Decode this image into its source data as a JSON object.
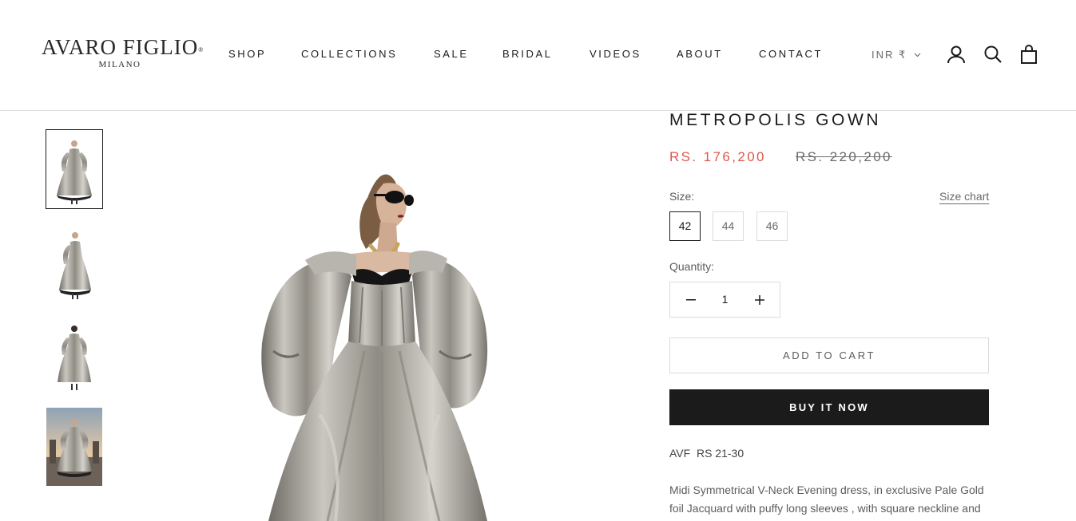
{
  "brand": {
    "logo_main": "AVARO FIGLIO",
    "logo_mark": "®",
    "logo_sub": "MILANO"
  },
  "nav": {
    "items": [
      {
        "label": "SHOP"
      },
      {
        "label": "COLLECTIONS"
      },
      {
        "label": "SALE"
      },
      {
        "label": "BRIDAL"
      },
      {
        "label": "VIDEOS"
      },
      {
        "label": "ABOUT"
      },
      {
        "label": "CONTACT"
      }
    ]
  },
  "header": {
    "currency": "INR ₹",
    "icons": [
      "account-icon",
      "search-icon",
      "cart-icon"
    ]
  },
  "gallery": {
    "thumbnails": [
      {
        "icon": "gown-front-thumbnail",
        "selected": true
      },
      {
        "icon": "gown-side-thumbnail",
        "selected": false
      },
      {
        "icon": "gown-back-thumbnail",
        "selected": false
      },
      {
        "icon": "gown-outdoor-thumbnail",
        "selected": false
      }
    ],
    "main_image": "metallic-gown-photo"
  },
  "product": {
    "title": "METROPOLIS GOWN",
    "price": "RS. 176,200",
    "compare_price": "RS. 220,200",
    "size_label": "Size:",
    "size_chart_label": "Size chart",
    "sizes": [
      "42",
      "44",
      "46"
    ],
    "selected_size": "42",
    "quantity_label": "Quantity:",
    "quantity": "1",
    "add_to_cart": "ADD TO CART",
    "buy_now": "BUY IT NOW",
    "sku": "AVF  RS 21-30",
    "description": "Midi Symmetrical V-Neck Evening dress, in exclusive Pale Gold foil Jacquard with puffy long sleeves , with square neckline and"
  },
  "colors": {
    "text": "#1c1b1b",
    "price_sale": "#e0554a",
    "muted": "#6a6a6a",
    "border": "#dcdcdc",
    "button_dark": "#1c1b1b"
  }
}
